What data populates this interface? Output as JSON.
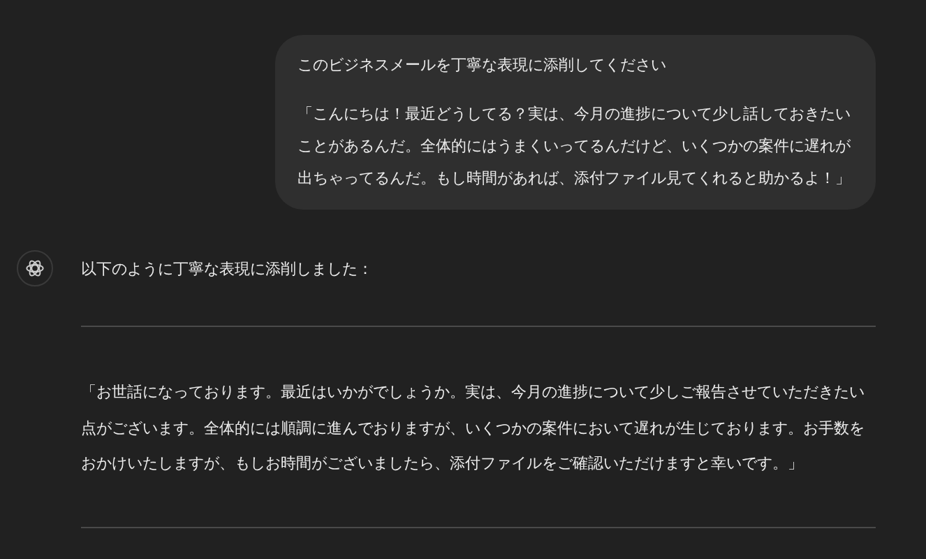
{
  "user_message": {
    "paragraphs": [
      "このビジネスメールを丁寧な表現に添削してください",
      "「こんにちは！最近どうしてる？実は、今月の進捗について少し話しておきたいことがあるんだ。全体的にはうまくいってるんだけど、いくつかの案件に遅れが出ちゃってるんだ。もし時間があれば、添付ファイル見てくれると助かるよ！」"
    ]
  },
  "assistant_message": {
    "intro": "以下のように丁寧な表現に添削しました：",
    "quote": "「お世話になっております。最近はいかがでしょうか。実は、今月の進捗について少しご報告させていただきたい点がございます。全体的には順調に進んでおりますが、いくつかの案件において遅れが生じております。お手数をおかけいたしますが、もしお時間がございましたら、添付ファイルをご確認いただけますと幸いです。」"
  }
}
